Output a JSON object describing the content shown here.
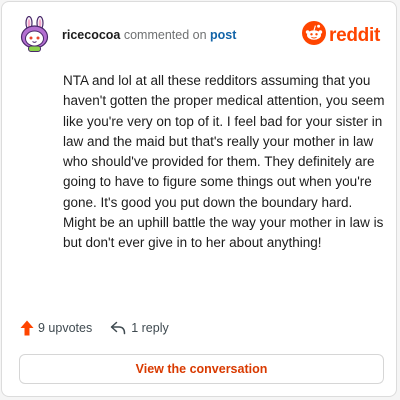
{
  "header": {
    "username": "ricecocoa",
    "action_text": "commented on",
    "post_link": "post",
    "avatar_icon": "snoo-avatar-icon",
    "brand": {
      "icon": "reddit-snoo-icon",
      "wordmark": "reddit",
      "color": "#ff4500"
    }
  },
  "comment": {
    "body": "NTA and lol at all these redditors assuming that you haven't gotten the proper medical attention, you seem like you're very on top of it. I feel bad for your sister in law and the maid but that's really your mother in law who should've provided for them. They definitely are going to have to figure some things out when you're gone. It's good you put down the boundary hard. Might be an uphill battle the way your mother in law is but don't ever give in to her about anything!"
  },
  "actions": {
    "upvotes_icon": "upvote-arrow-icon",
    "upvotes_label": "9 upvotes",
    "reply_icon": "reply-arrow-icon",
    "reply_label": "1 reply"
  },
  "cta": {
    "label": "View the conversation",
    "color": "#d93a00"
  }
}
